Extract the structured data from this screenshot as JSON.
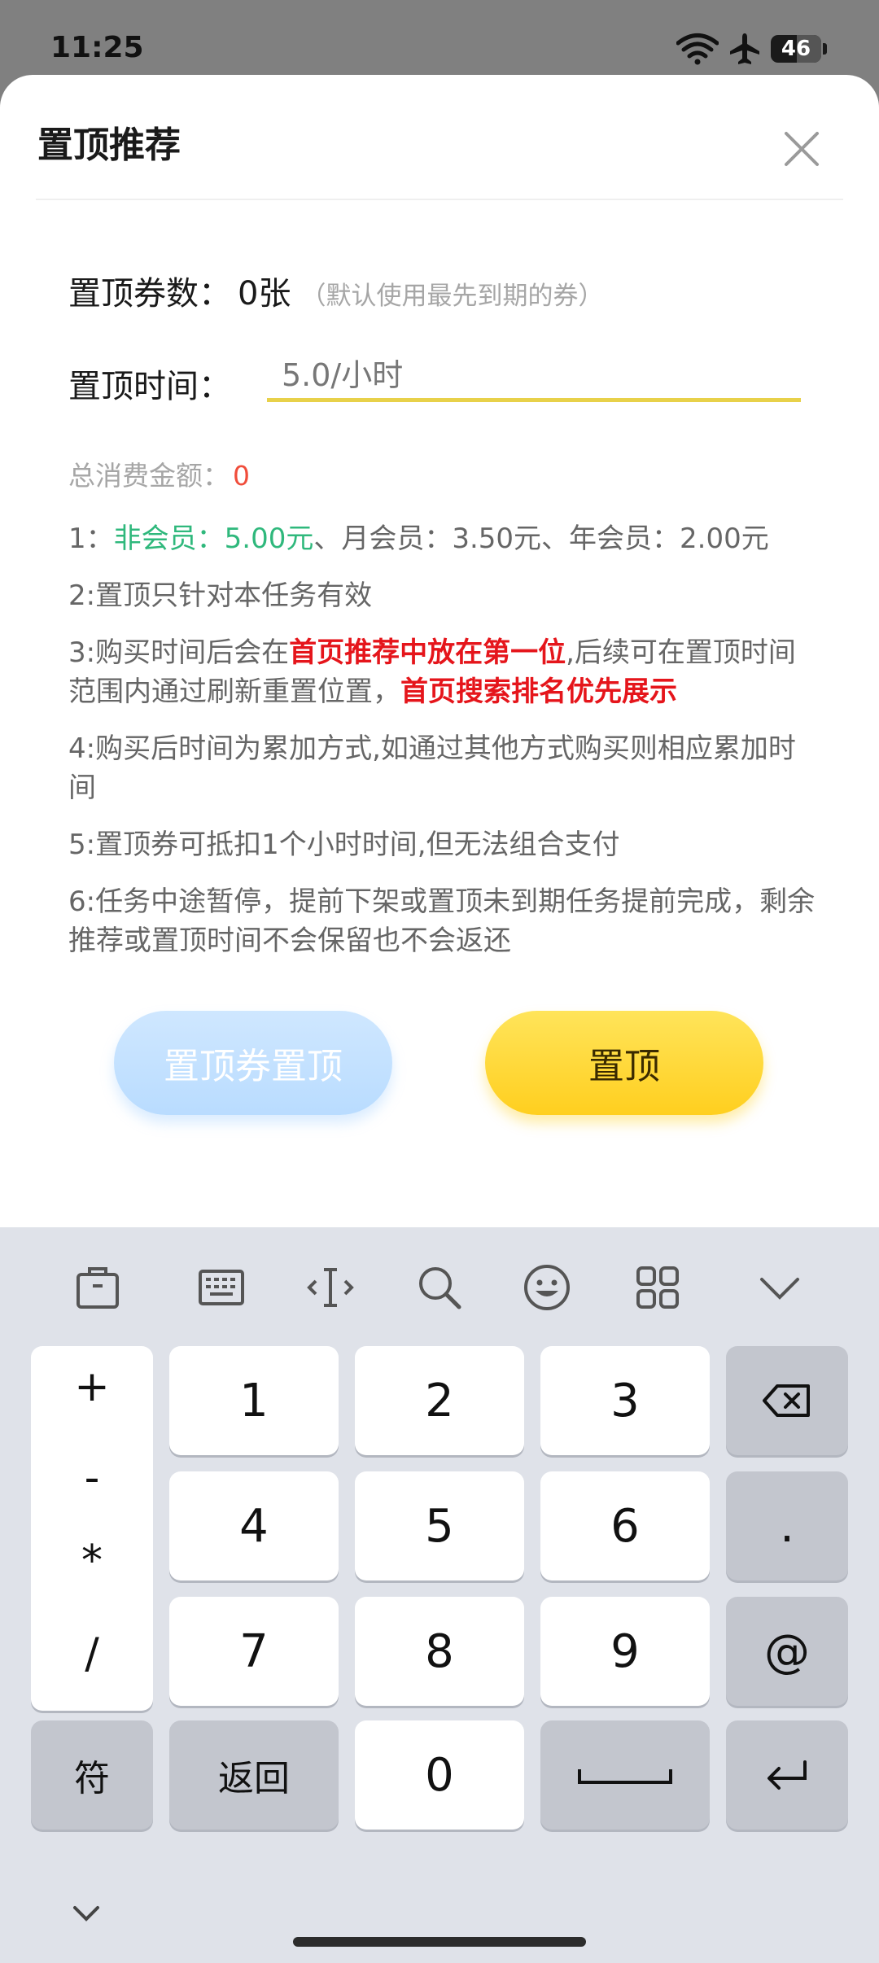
{
  "status_bar": {
    "time": "11:25",
    "battery_level": "46"
  },
  "sheet": {
    "title": "置顶推荐",
    "coupon_label": "置顶券数：",
    "coupon_count": "0张",
    "coupon_note": "（默认使用最先到期的券）",
    "time_label": "置顶时间：",
    "time_placeholder": "5.0/小时",
    "time_value": "",
    "total_label": "总消费金额：",
    "total_value": "0",
    "rules": {
      "r1_prefix": "1：",
      "r1_green": "非会员：5.00元",
      "r1_rest": "、月会员：3.50元、年会员：2.00元",
      "r2": "2:置顶只针对本任务有效",
      "r3_a": "3:购买时间后会在",
      "r3_b": "首页推荐中放在第一位",
      "r3_c": ",后续可在置顶时间范围内通过刷新重置位置，",
      "r3_d": "首页搜索排名优先展示",
      "r4": "4:购买后时间为累加方式,如通过其他方式购买则相应累加时间",
      "r5": "5:置顶券可抵扣1个小时时间,但无法组合支付",
      "r6": "6:任务中途暂停，提前下架或置顶未到期任务提前完成，剩余推荐或置顶时间不会保留也不会返还"
    },
    "btn_coupon_top": "置顶券置顶",
    "btn_top": "置顶"
  },
  "keyboard": {
    "toolbar_icons": [
      "clipboard-icon",
      "keyboard-icon",
      "cursor-icon",
      "search-icon",
      "emoji-icon",
      "apps-icon",
      "chevron-down-icon"
    ],
    "symbols": [
      "+",
      "-",
      "*",
      "/"
    ],
    "digits": [
      "1",
      "2",
      "3",
      "4",
      "5",
      "6",
      "7",
      "8",
      "9",
      "0"
    ],
    "dot": ".",
    "at": "@",
    "fu": "符",
    "back": "返回"
  },
  "colors": {
    "accent_yellow": "#ffd426",
    "light_blue": "#c4e1ff",
    "green": "#2fb87c",
    "red": "#e5151b",
    "underline": "#e8d14a"
  }
}
